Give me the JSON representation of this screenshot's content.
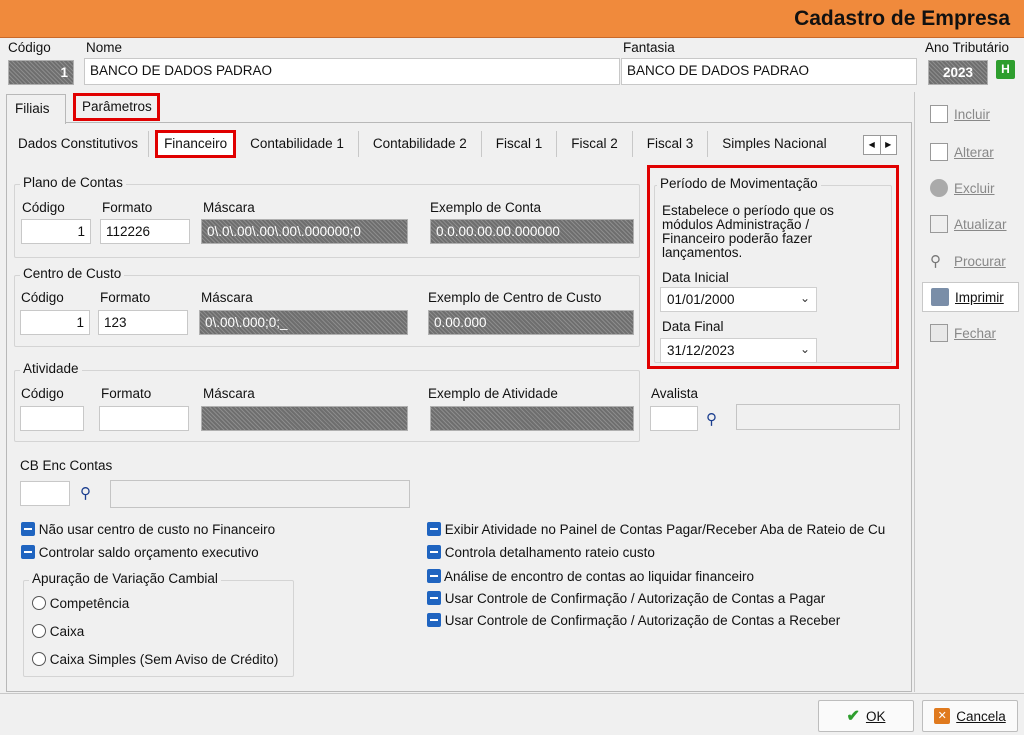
{
  "window": {
    "title": "Cadastro de Empresa"
  },
  "header": {
    "codigo_label": "Código",
    "codigo_value": "1",
    "nome_label": "Nome",
    "nome_value": "BANCO DE DADOS PADRAO",
    "fantasia_label": "Fantasia",
    "fantasia_value": "BANCO DE DADOS PADRAO",
    "ano_label": "Ano Tributário",
    "ano_value": "2023",
    "ano_badge": "H"
  },
  "top_tabs": [
    "Filiais",
    "Parâmetros"
  ],
  "sub_tabs": [
    "Dados Constitutivos",
    "Financeiro",
    "Contabilidade 1",
    "Contabilidade 2",
    "Fiscal 1",
    "Fiscal 2",
    "Fiscal 3",
    "Simples Nacional"
  ],
  "plano": {
    "title": "Plano de Contas",
    "codigo_label": "Código",
    "codigo_value": "1",
    "formato_label": "Formato",
    "formato_value": "112226",
    "mascara_label": "Máscara",
    "mascara_value": "0\\.0\\.00\\.00\\.00\\.000000;0",
    "exemplo_label": "Exemplo de Conta",
    "exemplo_value": "0.0.00.00.00.000000"
  },
  "centro": {
    "title": "Centro de Custo",
    "codigo_label": "Código",
    "codigo_value": "1",
    "formato_label": "Formato",
    "formato_value": "123",
    "mascara_label": "Máscara",
    "mascara_value": "0\\.00\\.000;0;_",
    "exemplo_label": "Exemplo de Centro de Custo",
    "exemplo_value": "0.00.000"
  },
  "atividade": {
    "title": "Atividade",
    "codigo_label": "Código",
    "formato_label": "Formato",
    "mascara_label": "Máscara",
    "exemplo_label": "Exemplo de Atividade"
  },
  "periodo": {
    "title": "Período de Movimentação",
    "desc": "Estabelece o período que os módulos Administração / Financeiro poderão fazer lançamentos.",
    "inicial_label": "Data Inicial",
    "inicial_value": "01/01/2000",
    "final_label": "Data Final",
    "final_value": "31/12/2023"
  },
  "avalista_label": "Avalista",
  "cb_label": "CB Enc Contas",
  "checks_left": [
    "Não usar centro de custo no Financeiro",
    "Controlar saldo orçamento executivo"
  ],
  "checks_right": [
    "Exibir Atividade no Painel de Contas Pagar/Receber Aba de Rateio de Cu",
    "Controla detalhamento rateio custo",
    "Análise de encontro de contas ao liquidar financeiro",
    "Usar Controle de Confirmação / Autorização de Contas a Pagar",
    "Usar Controle de Confirmação / Autorização de Contas a Receber"
  ],
  "cambial": {
    "title": "Apuração de Variação Cambial",
    "options": [
      "Competência",
      "Caixa",
      "Caixa Simples (Sem Aviso de Crédito)"
    ]
  },
  "side_buttons": [
    "Incluir",
    "Alterar",
    "Excluir",
    "Atualizar",
    "Procurar",
    "Imprimir",
    "Fechar"
  ],
  "footer": {
    "ok": "OK",
    "cancel": "Cancela"
  },
  "colors": {
    "titlebar": "#f08a3c",
    "highlight": "#e00000",
    "check": "#1f64c0"
  }
}
